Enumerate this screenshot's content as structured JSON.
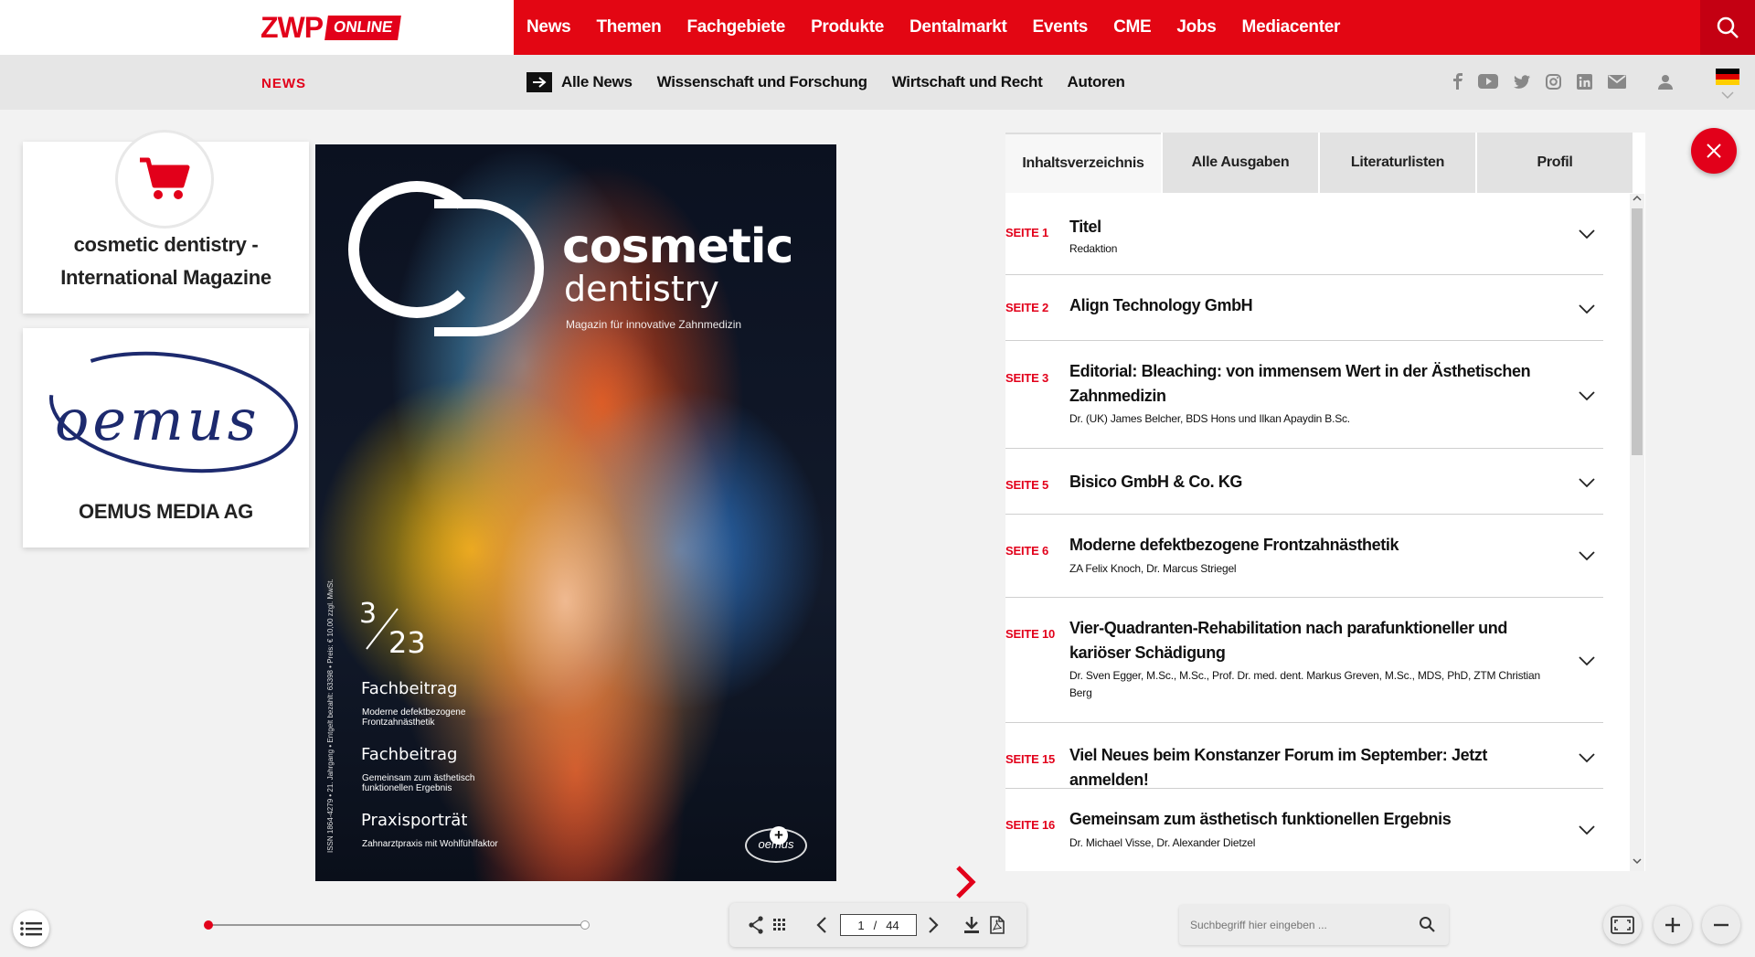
{
  "header": {
    "logo_main": "ZWP",
    "logo_badge": "ONLINE",
    "nav": [
      "News",
      "Themen",
      "Fachgebiete",
      "Produkte",
      "Dentalmarkt",
      "Events",
      "CME",
      "Jobs",
      "Mediacenter"
    ]
  },
  "subnav": {
    "section": "NEWS",
    "links": [
      "Alle News",
      "Wissenschaft und Forschung",
      "Wirtschaft und Recht",
      "Autoren"
    ],
    "social_icons": [
      "facebook-icon",
      "youtube-icon",
      "twitter-icon",
      "instagram-icon",
      "linkedin-icon",
      "mail-icon",
      "user-icon"
    ],
    "language": "de"
  },
  "cards": {
    "shop_title": "cosmetic dentistry - International Magazine",
    "publisher_logo": "oemus",
    "publisher_title": "OEMUS MEDIA AG"
  },
  "cover": {
    "brand1": "cosmetic",
    "brand2": "dentistry",
    "subtitle": "Magazin für innovative Zahnmedizin",
    "issue_num": "3",
    "issue_year": "23",
    "topics": [
      {
        "heading": "Fachbeitrag",
        "sub": "Moderne defektbezogene Frontzahnästhetik"
      },
      {
        "heading": "Fachbeitrag",
        "sub": "Gemeinsam zum ästhetisch funktionellen Ergebnis"
      },
      {
        "heading": "Praxisporträt",
        "sub": "Zahnarztpraxis mit Wohlfühlfaktor"
      }
    ],
    "side_text": "ISSN 1864-4279 • 21. Jahrgang • Entgelt bezahlt: 63398 • Preis: € 10,00 zzgl. MwSt.",
    "logo": "oemus"
  },
  "tabs": [
    "Inhaltsverzeichnis",
    "Alle Ausgaben",
    "Literaturlisten",
    "Profil"
  ],
  "toc": [
    {
      "page": "SEITE 1",
      "title": "Titel",
      "author": "Redaktion"
    },
    {
      "page": "SEITE 2",
      "title": "Align Technology GmbH",
      "author": ""
    },
    {
      "page": "SEITE 3",
      "title": "Editorial: Bleaching: von immensem Wert in der Ästhetischen Zahnmedizin",
      "author": "Dr. (UK) James Belcher, BDS Hons und Ilkan Apaydin B.Sc."
    },
    {
      "page": "SEITE 5",
      "title": "Bisico GmbH & Co. KG",
      "author": ""
    },
    {
      "page": "SEITE 6",
      "title": "Moderne defektbezogene Frontzahnästhetik",
      "author": "ZA Felix Knoch, Dr. Marcus Striegel"
    },
    {
      "page": "SEITE 10",
      "title": "Vier-Quadranten-Rehabilitation nach parafunktioneller und kariöser Schädigung",
      "author": "Dr. Sven Egger, M.Sc., M.Sc., Prof. Dr. med. dent. Markus Greven, M.Sc., MDS, PhD, ZTM Christian Berg"
    },
    {
      "page": "SEITE 15",
      "title": "Viel Neues beim Konstanzer Forum im September: Jetzt anmelden!",
      "author": ""
    },
    {
      "page": "SEITE 16",
      "title": "Gemeinsam zum ästhetisch funktionellen Ergebnis",
      "author": "Dr. Michael Visse, Dr. Alexander Dietzel"
    }
  ],
  "viewer": {
    "current_page": "1",
    "separator": "/",
    "total_pages": "44",
    "progress": 0.0,
    "search_placeholder": "Suchbegriff hier eingeben ..."
  },
  "colors": {
    "brand_red": "#e30613",
    "dark_red": "#c40012",
    "subnav_bg": "#e6e6e6",
    "page_bg": "#f2f2f2"
  }
}
